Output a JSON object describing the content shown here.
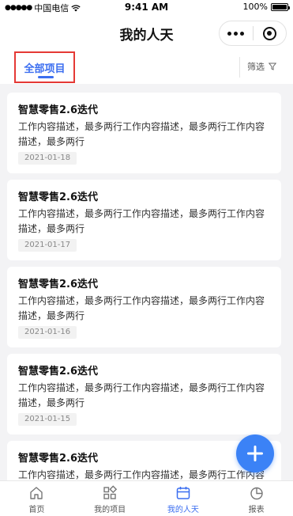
{
  "status_bar": {
    "signal": "●●●●●",
    "carrier": "中国电信",
    "time": "9:41 AM",
    "battery": "100%"
  },
  "header": {
    "title": "我的人天"
  },
  "tabs": {
    "all_projects": "全部项目",
    "filter_label": "筛选"
  },
  "items": [
    {
      "title": "智慧零售2.6迭代",
      "description": "工作内容描述，最多两行工作内容描述，最多两行工作内容描述，最多两行",
      "date": "2021-01-18"
    },
    {
      "title": "智慧零售2.6迭代",
      "description": "工作内容描述，最多两行工作内容描述，最多两行工作内容描述，最多两行",
      "date": "2021-01-17"
    },
    {
      "title": "智慧零售2.6迭代",
      "description": "工作内容描述，最多两行工作内容描述，最多两行工作内容描述，最多两行",
      "date": "2021-01-16"
    },
    {
      "title": "智慧零售2.6迭代",
      "description": "工作内容描述，最多两行工作内容描述，最多两行工作内容描述，最多两行",
      "date": "2021-01-15"
    },
    {
      "title": "智慧零售2.6迭代",
      "description": "工作内容描述，最多两行工作内容描述，最多两行工作内容描述，最多两行",
      "date": ""
    }
  ],
  "bottom_nav": [
    {
      "label": "首页",
      "icon": "home-icon",
      "active": false
    },
    {
      "label": "我的项目",
      "icon": "grid-icon",
      "active": false
    },
    {
      "label": "我的人天",
      "icon": "calendar-icon",
      "active": true
    },
    {
      "label": "报表",
      "icon": "pie-chart-icon",
      "active": false
    }
  ],
  "colors": {
    "accent": "#3b6ef0",
    "fab": "#3b82f6",
    "highlight_box": "#e53935",
    "background": "#f3f3f5"
  }
}
